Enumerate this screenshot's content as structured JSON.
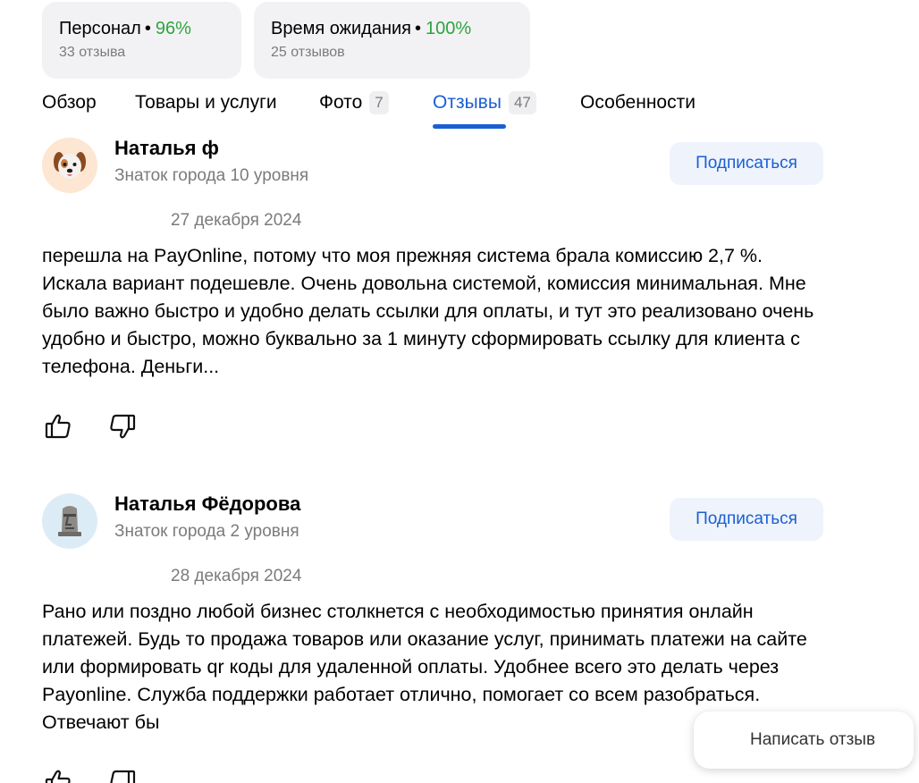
{
  "aspects": [
    {
      "name": "Персонал",
      "pct": "96%",
      "count": "33 отзыва"
    },
    {
      "name": "Время ожидания",
      "pct": "100%",
      "count": "25 отзывов"
    }
  ],
  "tabs": [
    {
      "label": "Обзор",
      "count": null
    },
    {
      "label": "Товары и услуги",
      "count": null
    },
    {
      "label": "Фото",
      "count": "7"
    },
    {
      "label": "Отзывы",
      "count": "47",
      "active": true
    },
    {
      "label": "Особенности",
      "count": null
    }
  ],
  "reviews": [
    {
      "author": "Наталья ф",
      "level": "Знаток города 10 уровня",
      "subscribe_label": "Подписаться",
      "date": "27 декабря 2024",
      "text": "перешла на PayOnline, потому что моя прежняя система брала комиссию 2,7 %. Искала вариант подешевле. Очень довольна системой, комиссия минимальная. Мне было важно быстро и удобно делать ссылки для оплаты, и тут это реализовано очень удобно и быстро, можно буквально за 1 минуту сформировать ссылку для клиента с телефона. Деньги...",
      "avatar": "dog-face-icon"
    },
    {
      "author": "Наталья Фёдорова",
      "level": "Знаток города 2 уровня",
      "subscribe_label": "Подписаться",
      "date": "28 декабря 2024",
      "text": "Рано или поздно любой бизнес столкнется с необходимостью принятия онлайн платежей. Будь то продажа товаров или оказание услуг, принимать платежи на сайте или формировать qr коды для удаленной оплаты. Удобнее всего это делать через Payonline. Служба поддержки работает отлично, помогает со всем разобраться. Отвечают бы",
      "avatar": "moai-icon"
    }
  ],
  "write_review_label": "Написать отзыв",
  "colors": {
    "accent": "#1a5fd4",
    "positive": "#2fa43d",
    "muted": "#7b7b7b"
  }
}
